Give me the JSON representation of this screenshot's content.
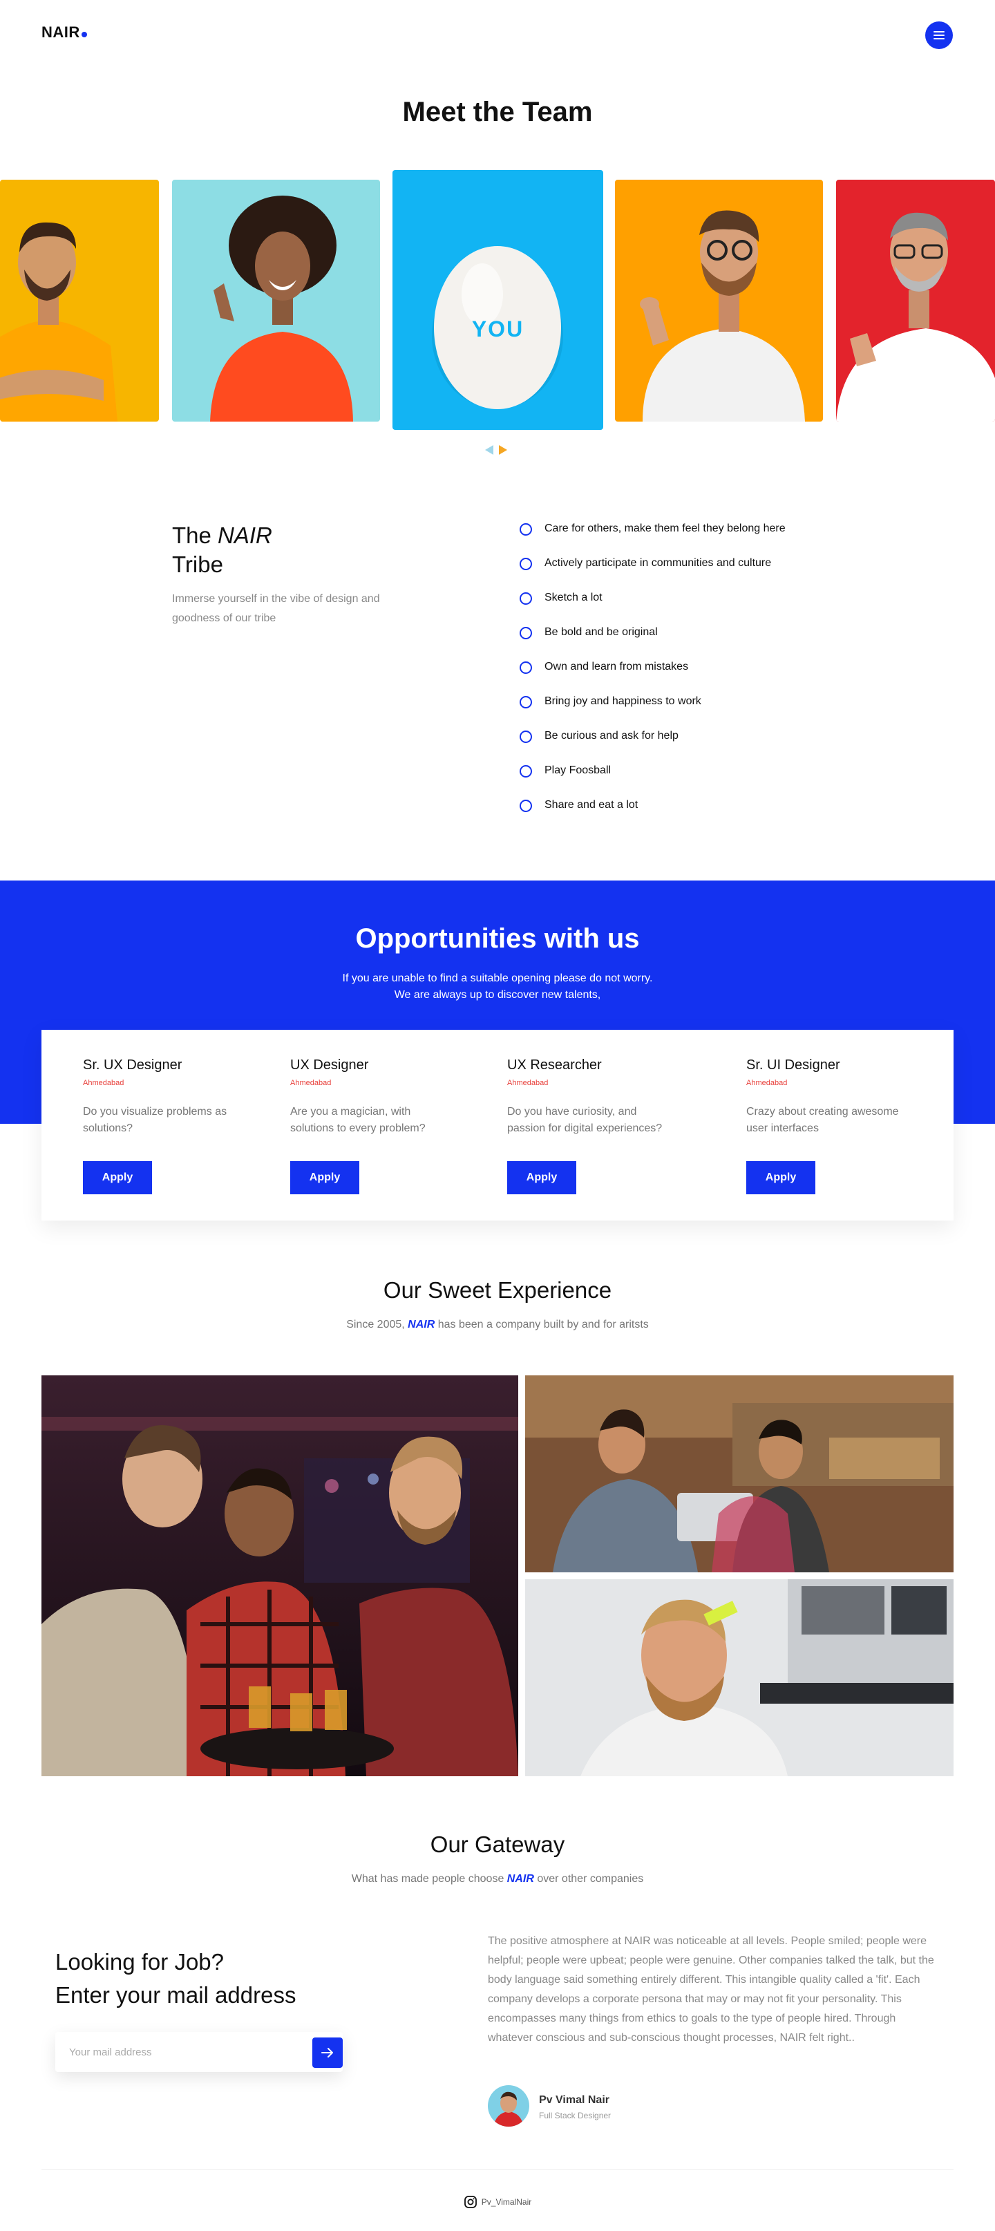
{
  "header": {
    "logo": "NAIR",
    "menu_icon": "hamburger-icon"
  },
  "team": {
    "title": "Meet the Team",
    "center_card_text": "YOU",
    "cards": [
      {
        "bg": "#f7b500",
        "shirt": "#ffb000"
      },
      {
        "bg": "#8ddde4",
        "shirt": "#ff4b1f"
      },
      {
        "bg": "#12b4f3",
        "shirt": ""
      },
      {
        "bg": "#ffa000",
        "shirt": "#f2f2f2"
      },
      {
        "bg": "#e3232c",
        "shirt": "#ffffff"
      }
    ],
    "prev_icon": "triangle-left-icon",
    "next_icon": "triangle-right-icon"
  },
  "tribe": {
    "title_prefix": "The ",
    "title_brand": "NAIR",
    "title_suffix": "Tribe",
    "subtitle": "Immerse yourself in the vibe of design and goodness of our tribe",
    "values": [
      "Care for others, make them feel they belong here",
      "Actively participate in communities and culture",
      "Sketch a lot",
      "Be bold and be original",
      "Own and learn from mistakes",
      "Bring joy and happiness to work",
      "Be curious and ask for help",
      "Play Foosball",
      "Share and eat a lot"
    ]
  },
  "opportunities": {
    "title": "Opportunities with us",
    "subtitle_line1": "If you are unable to find a suitable opening please do not worry.",
    "subtitle_line2": "We are always up to discover new talents,",
    "jobs": [
      {
        "title": "Sr. UX Designer",
        "location": "Ahmedabad",
        "description": "Do you visualize problems as solutions?",
        "button": "Apply"
      },
      {
        "title": "UX Designer",
        "location": "Ahmedabad",
        "description": "Are you a magician, with solutions to every problem?",
        "button": "Apply"
      },
      {
        "title": "UX Researcher",
        "location": "Ahmedabad",
        "description": "Do you have curiosity, and passion for digital experiences?",
        "button": "Apply"
      },
      {
        "title": "Sr. UI Designer",
        "location": "Ahmedabad",
        "description": "Crazy about creating awesome user interfaces",
        "button": "Apply"
      }
    ]
  },
  "experience": {
    "title": "Our Sweet Experience",
    "subtitle_prefix": "Since 2005, ",
    "subtitle_brand": "NAIR",
    "subtitle_suffix": " has been a company built by and for aritsts"
  },
  "gateway": {
    "title": "Our Gateway",
    "subtitle_prefix": "What has made people choose ",
    "subtitle_brand": "NAIR",
    "subtitle_suffix": " over other companies",
    "cta_line1": "Looking for Job?",
    "cta_line2": "Enter your mail address",
    "email_placeholder": "Your mail address",
    "submit_icon": "arrow-right-icon",
    "testimonial": "The positive atmosphere at NAIR was noticeable at all levels. People smiled; people were helpful; people were upbeat; people were genuine. Other companies talked the talk, but the body language said something entirely different. This intangible quality called a 'fit'. Each company develops a corporate persona that may or may not fit your personality. This encompasses many things from ethics to goals to the type of people hired. Through whatever conscious and sub-conscious thought processes, NAIR felt right..",
    "author_name": "Pv Vimal Nair",
    "author_role": "Full Stack Designer"
  },
  "footer": {
    "social_icon": "instagram-icon",
    "handle": "Pv_VimalNair"
  },
  "colors": {
    "brand_blue": "#1432f0",
    "location_red": "#e8413c"
  }
}
